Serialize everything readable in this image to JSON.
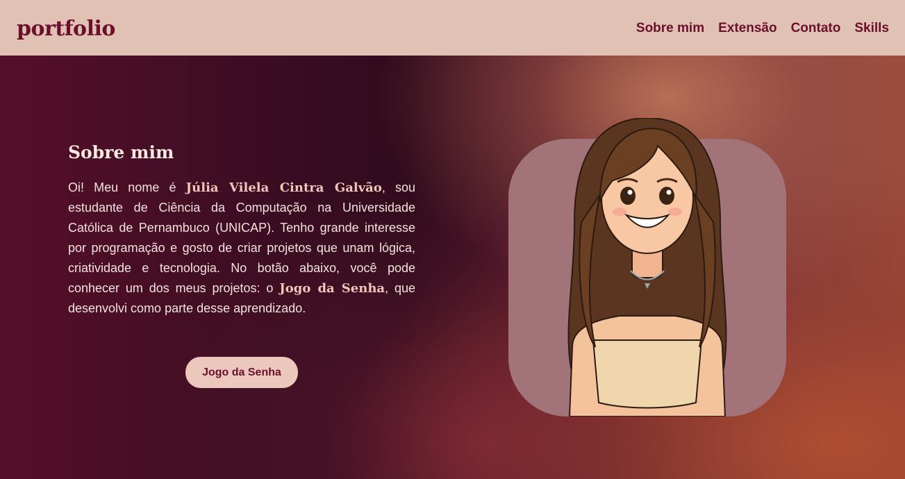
{
  "header": {
    "logo": "portfolio",
    "nav": [
      "Sobre mim",
      "Extensão",
      "Contato",
      "Skills"
    ]
  },
  "about": {
    "title": "Sobre mim",
    "intro_before_name": "Oi! Meu nome é ",
    "name": "Júlia Vilela Cintra Galvão",
    "intro_after_name": ", sou estudante de Ciência da Computação na Universidade Católica de Pernambuco (UNICAP). Tenho grande interesse por programação e gosto de criar projetos que unam lógica, criatividade e tecnologia. No botão abaixo, você pode conhecer um dos meus projetos: o ",
    "project_name": "Jogo da Senha",
    "intro_end": ", que desenvolvi como parte desse aprendizado.",
    "button_label": "Jogo da Senha"
  },
  "colors": {
    "header_bg": "#e2c1b5",
    "brand": "#6a0f2c",
    "button_bg": "#ecc8bc",
    "highlight": "#f0c6b8"
  },
  "illustration": "avatar-illustration"
}
